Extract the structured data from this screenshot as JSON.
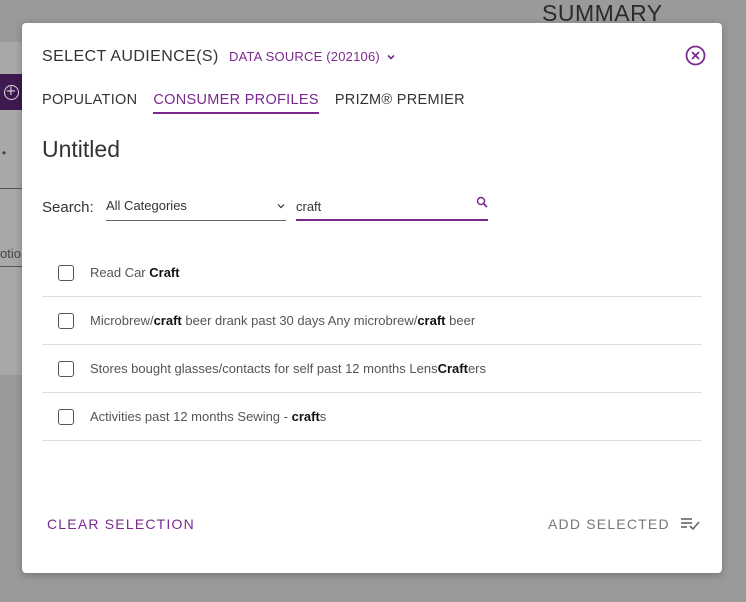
{
  "background": {
    "summary_label": "SUMMARY",
    "partial_text": "otio"
  },
  "modal": {
    "title": "SELECT AUDIENCE(S)",
    "data_source_label": "DATA SOURCE (202106)",
    "tabs": [
      {
        "label": "POPULATION",
        "active": false
      },
      {
        "label": "CONSUMER PROFILES",
        "active": true
      },
      {
        "label": "PRIZM® PREMIER",
        "active": false
      }
    ],
    "audience_name": "Untitled",
    "search": {
      "label": "Search:",
      "category_value": "All Categories",
      "query_value": "craft"
    },
    "results": [
      {
        "before": "Read Car ",
        "match": "Craft",
        "after": "",
        "checked": false
      },
      {
        "before": "Microbrew/",
        "match": "craft",
        "after": " beer drank past 30 days Any microbrew/",
        "match2": "craft",
        "after2": " beer",
        "checked": false
      },
      {
        "before": "Stores bought glasses/contacts for self past 12 months Lens",
        "match": "Craft",
        "after": "ers",
        "checked": false
      },
      {
        "before": "Activities past 12 months Sewing - ",
        "match": "craft",
        "after": "s",
        "checked": false
      }
    ],
    "clear_label": "CLEAR SELECTION",
    "add_label": "ADD SELECTED",
    "colors": {
      "accent": "#7a2a8e",
      "overlay": "#8a8a8a"
    }
  }
}
